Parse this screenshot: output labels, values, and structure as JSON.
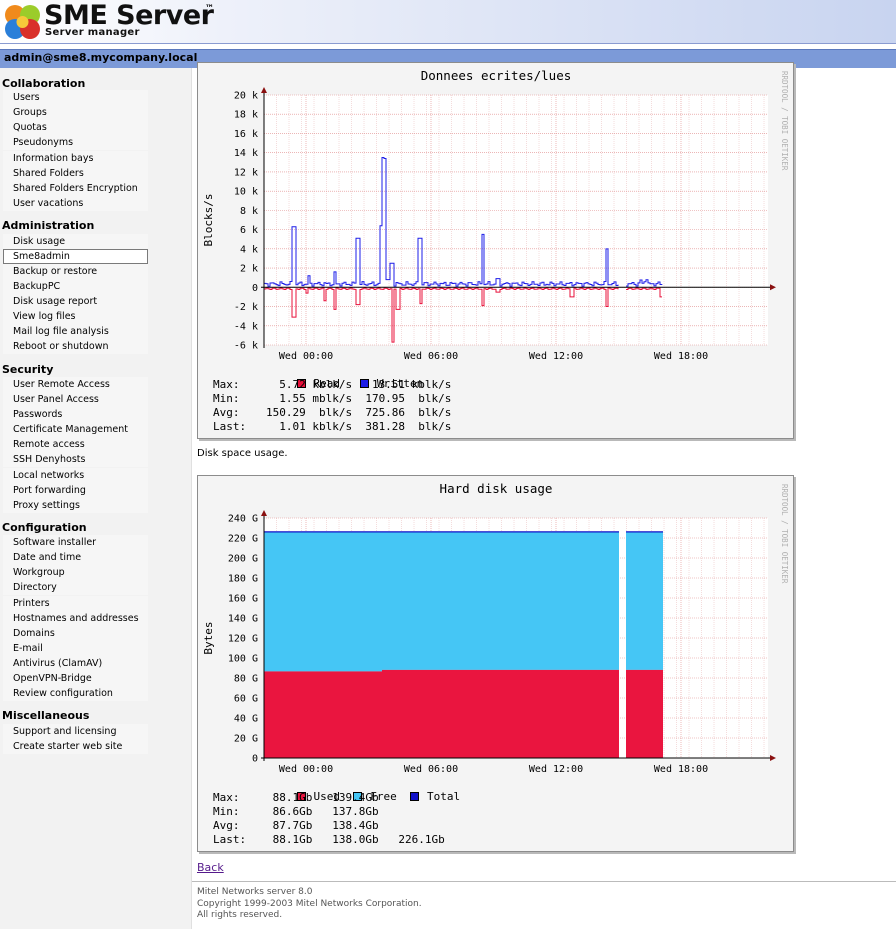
{
  "header": {
    "brand_title": "SME Server",
    "brand_tm": "™",
    "brand_subtitle": "Server manager"
  },
  "userbar": {
    "text": "admin@sme8.mycompany.local"
  },
  "sidebar": {
    "sections": [
      {
        "title": "Collaboration",
        "items": [
          "Users",
          "Groups",
          "Quotas",
          "Pseudonyms",
          "Information bays",
          "Shared Folders",
          "Shared Folders Encryption",
          "User vacations"
        ]
      },
      {
        "title": "Administration",
        "items": [
          "Disk usage",
          "Sme8admin",
          "Backup or restore",
          "BackupPC",
          "Disk usage report",
          "View log files",
          "Mail log file analysis",
          "Reboot or shutdown"
        ],
        "active": "Sme8admin"
      },
      {
        "title": "Security",
        "items": [
          "User Remote Access",
          "User Panel Access",
          "Passwords",
          "Certificate Management",
          "Remote access",
          "SSH Denyhosts",
          "Local networks",
          "Port forwarding",
          "Proxy settings"
        ]
      },
      {
        "title": "Configuration",
        "items": [
          "Software installer",
          "Date and time",
          "Workgroup",
          "Directory",
          "Printers",
          "Hostnames and addresses",
          "Domains",
          "E-mail",
          "Antivirus (ClamAV)",
          "OpenVPN-Bridge",
          "Review configuration"
        ]
      },
      {
        "title": "Miscellaneous",
        "items": [
          "Support and licensing",
          "Create starter web site"
        ]
      }
    ]
  },
  "graphs": {
    "io": {
      "title": "Donnees ecrites/lues",
      "ylabel": "Blocks/s",
      "watermark": "RRDTOOL / TOBI OETIKER",
      "y_ticks": [
        "20 k",
        "18 k",
        "16 k",
        "14 k",
        "12 k",
        "10 k",
        "8 k",
        "6 k",
        "4 k",
        "2 k",
        "0",
        "-2 k",
        "-4 k",
        "-6 k"
      ],
      "x_ticks": [
        "Wed 00:00",
        "Wed 06:00",
        "Wed 12:00",
        "Wed 18:00"
      ],
      "legend": [
        {
          "label": "Read",
          "color": "#e8103a"
        },
        {
          "label": "Written",
          "color": "#1d1de8"
        }
      ],
      "stats": [
        "Max:      5.72 kblk/s   13.51 kblk/s",
        "Min:      1.55 mblk/s  170.95  blk/s",
        "Avg:    150.29  blk/s  725.86  blk/s",
        "Last:     1.01 kblk/s  381.28  blk/s"
      ]
    },
    "disk_caption": "Disk space usage.",
    "disk": {
      "title": "Hard disk usage",
      "ylabel": "Bytes",
      "watermark": "RRDTOOL / TOBI OETIKER",
      "y_ticks": [
        "240 G",
        "220 G",
        "200 G",
        "180 G",
        "160 G",
        "140 G",
        "120 G",
        "100 G",
        "80 G",
        "60 G",
        "40 G",
        "20 G",
        "0"
      ],
      "x_ticks": [
        "Wed 00:00",
        "Wed 06:00",
        "Wed 12:00",
        "Wed 18:00"
      ],
      "legend": [
        {
          "label": "Used",
          "color": "#ea153f"
        },
        {
          "label": "Free",
          "color": "#45c6f5"
        },
        {
          "label": "Total",
          "color": "#1010c8"
        }
      ],
      "stats": [
        "Max:     88.1Gb   139.4Gb",
        "Min:     86.6Gb   137.8Gb",
        "Avg:     87.7Gb   138.4Gb",
        "Last:    88.1Gb   138.0Gb   226.1Gb"
      ]
    }
  },
  "back_link": "Back",
  "footer": {
    "line1": "Mitel Networks server 8.0",
    "line2": "Copyright 1999-2003 Mitel Networks Corporation.",
    "line3": "All rights reserved."
  }
}
